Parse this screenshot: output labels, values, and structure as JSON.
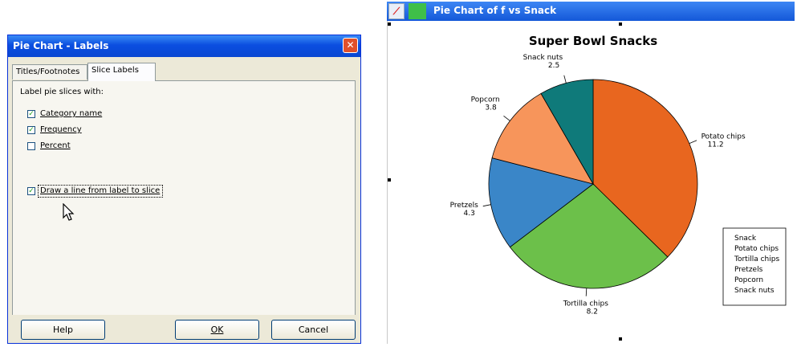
{
  "dialog": {
    "title": "Pie Chart - Labels",
    "close_glyph": "✕",
    "tabs": [
      {
        "label": "Titles/Footnotes"
      },
      {
        "label": "Slice Labels"
      }
    ],
    "label_prompt": "Label pie slices with:",
    "options": [
      {
        "label": "Category name",
        "checked": true
      },
      {
        "label": "Frequency",
        "checked": true
      },
      {
        "label": "Percent",
        "checked": false
      }
    ],
    "draw_line": {
      "label": "Draw a line from label to slice",
      "checked": true
    },
    "check_glyph": "✓",
    "buttons": {
      "help": "Help",
      "ok": "OK",
      "cancel": "Cancel"
    }
  },
  "chart_window": {
    "title": "Pie Chart of f vs Snack",
    "icon": "chart-window-icon"
  },
  "chart_data": {
    "type": "pie",
    "title": "Super Bowl Snacks",
    "slices": [
      {
        "label": "Potato chips",
        "value": 11.2,
        "value_text": "11.2",
        "color": "#e8661f"
      },
      {
        "label": "Tortilla chips",
        "value": 8.2,
        "value_text": "8.2",
        "color": "#6cc04a"
      },
      {
        "label": "Pretzels",
        "value": 4.3,
        "value_text": "4.3",
        "color": "#3a86c8"
      },
      {
        "label": "Popcorn",
        "value": 3.8,
        "value_text": "3.8",
        "color": "#f7955b"
      },
      {
        "label": "Snack nuts",
        "value": 2.5,
        "value_text": "2.5",
        "color": "#0f7a7a"
      }
    ],
    "legend": {
      "title": "Snack",
      "entries": [
        "Potato chips",
        "Tortilla chips",
        "Pretzels",
        "Popcorn",
        "Snack nuts"
      ],
      "placement": "bottom-right"
    }
  }
}
